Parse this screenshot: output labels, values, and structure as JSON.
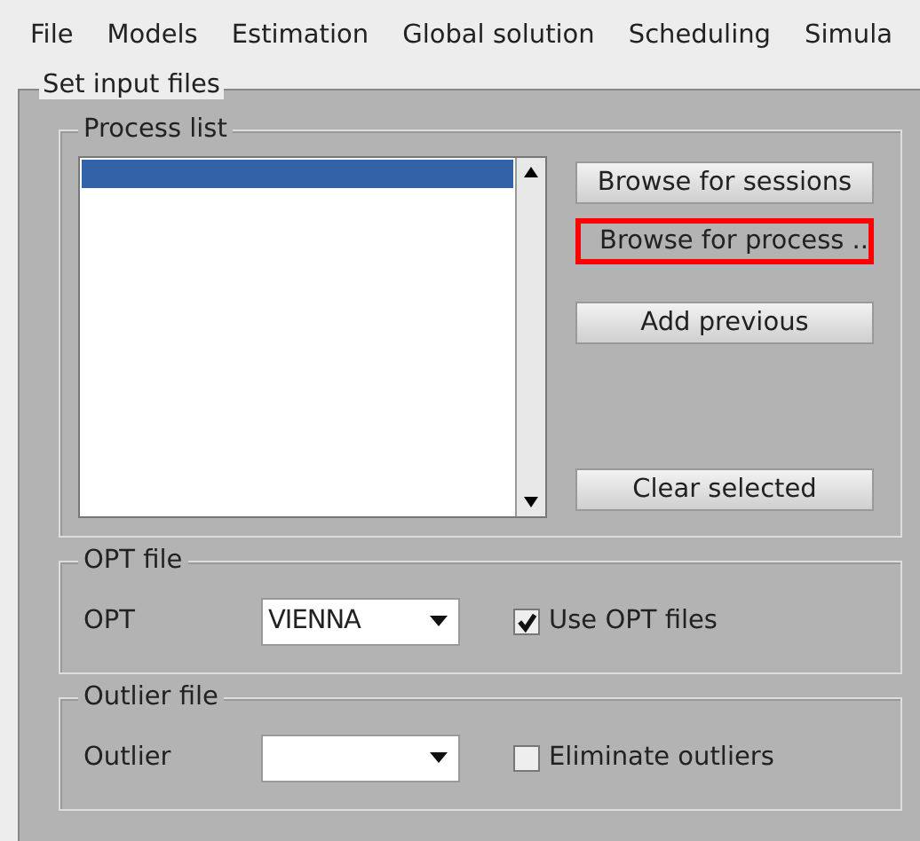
{
  "menu_bar": [
    "File",
    "Models",
    "Estimation",
    "Global solution",
    "Scheduling",
    "Simula"
  ],
  "panel": {
    "title": "Set input files"
  },
  "process_list": {
    "title": "Process list",
    "rows": [
      {
        "selected": true
      }
    ],
    "buttons": [
      {
        "label": "Browse for sessions",
        "highlighted": false
      },
      {
        "label": "Browse for process ..",
        "highlighted": true
      },
      {
        "label": "Add previous",
        "highlighted": false
      },
      {
        "label": "Clear selected",
        "highlighted": false
      }
    ]
  },
  "groups": [
    {
      "title": "OPT file",
      "label": "OPT",
      "value": "VIENNA",
      "checkbox": {
        "label": "Use OPT files",
        "checked": true
      }
    },
    {
      "title": "Outlier file",
      "label": "Outlier",
      "checkbox": {
        "label": "Eliminate outliers",
        "checked": false
      }
    }
  ]
}
